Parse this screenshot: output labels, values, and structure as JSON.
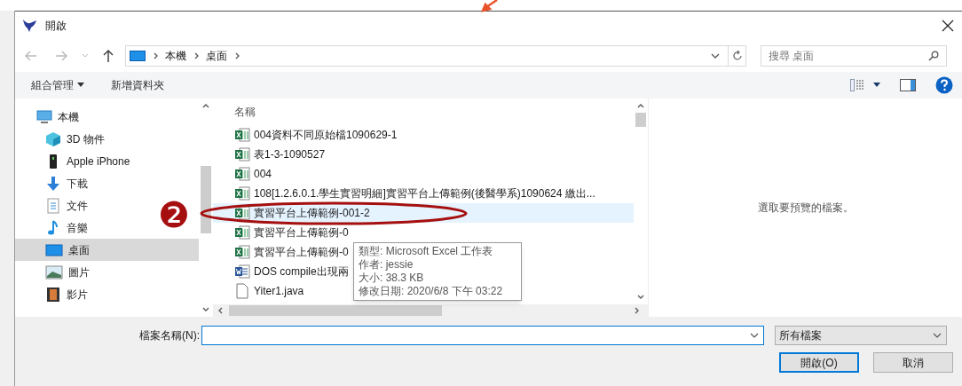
{
  "window": {
    "title": "開啟"
  },
  "address": {
    "path": [
      "本機",
      "桌面"
    ]
  },
  "search": {
    "placeholder": "搜尋 桌面"
  },
  "toolbar": {
    "organize": "組合管理",
    "new_folder": "新增資料夾"
  },
  "sidebar": {
    "items": [
      {
        "label": "本機",
        "kind": "pc",
        "selected": false
      },
      {
        "label": "3D 物件",
        "kind": "cube",
        "selected": false
      },
      {
        "label": "Apple iPhone",
        "kind": "phone",
        "selected": false
      },
      {
        "label": "下載",
        "kind": "download",
        "selected": false
      },
      {
        "label": "文件",
        "kind": "document",
        "selected": false
      },
      {
        "label": "音樂",
        "kind": "music",
        "selected": false
      },
      {
        "label": "桌面",
        "kind": "desktop",
        "selected": true
      },
      {
        "label": "圖片",
        "kind": "image",
        "selected": false
      },
      {
        "label": "影片",
        "kind": "video",
        "selected": false
      }
    ]
  },
  "files": {
    "column": "名稱",
    "items": [
      {
        "name": "004資料不同原始檔1090629-1",
        "kind": "excel",
        "selected": false
      },
      {
        "name": "表1-3-1090527",
        "kind": "excel",
        "selected": false
      },
      {
        "name": "004",
        "kind": "excel",
        "selected": false
      },
      {
        "name": "108[1.2.6.0.1.學生實習明細]實習平台上傳範例(後醫學系)1090624 繳出...",
        "kind": "excel",
        "selected": false
      },
      {
        "name": "實習平台上傳範例-001-2",
        "kind": "excel",
        "selected": true
      },
      {
        "name": "實習平台上傳範例-0",
        "kind": "excel",
        "selected": false
      },
      {
        "name": "實習平台上傳範例-0",
        "kind": "excel",
        "selected": false
      },
      {
        "name": "DOS compile出現兩",
        "kind": "word",
        "selected": false
      },
      {
        "name": "Yiter1.java",
        "kind": "plain",
        "selected": false
      }
    ]
  },
  "tooltip": {
    "lines": [
      "類型: Microsoft Excel 工作表",
      "作者: jessie",
      "大小: 38.3 KB",
      "修改日期: 2020/6/8 下午 03:22"
    ]
  },
  "preview": {
    "message": "選取要預覽的檔案。"
  },
  "footer": {
    "filename_label": "檔案名稱(N):",
    "filetype": "所有檔案",
    "buttons": [
      "開啟(O)",
      "取消"
    ]
  },
  "annotation": {
    "badge": "❷"
  }
}
